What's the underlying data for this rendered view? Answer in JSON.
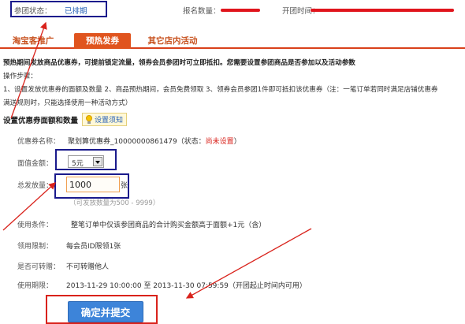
{
  "header": {
    "status_label": "参团状态：",
    "status_value": "已排期",
    "count_label": "报名数量：",
    "start_label": "开团时间："
  },
  "tabs": [
    {
      "label": "淘宝客推广",
      "active": false
    },
    {
      "label": "预热发券",
      "active": true
    },
    {
      "label": "其它店内活动",
      "active": false
    }
  ],
  "notice": {
    "headline": "预热期间发放商品优惠券，可提前锁定流量，领券会员参团时可立即抵扣。您需要设置参团商品是否参加以及活动参数",
    "steps_label": "操作步骤：",
    "steps_line1": "1、设置发放优惠券的面额及数量 2、商品预热期间，会员免费领取 3、领券会员参团1件即可抵扣该优惠券（注：一笔订单若同时满足店铺优惠券",
    "steps_line2": "满送规则时，只能选择使用一种活动方式）"
  },
  "section": {
    "title": "设置优惠券面额和数量",
    "add_setting": "设置须知"
  },
  "form": {
    "coupon_name_label": "优惠券名称：",
    "coupon_name_value": "聚划算优惠券_10000000861479（状态：",
    "coupon_status": "尚未设置",
    "coupon_name_close": "）",
    "face_value_label": "面值金额：",
    "face_value_selected": "5元",
    "total_label": "总发放量：",
    "total_value": "1000",
    "total_unit": "张",
    "total_hint": "（可发放数量为500 - 9999）",
    "condition_label": "使用条件：",
    "condition_value": "整笔订单中仅该参团商品的合计购买金额高于面额+1元（含）",
    "limit_label": "领用限制：",
    "limit_value": "每会员ID限领1张",
    "transfer_label": "是否可转赠：",
    "transfer_value": "不可转赠他人",
    "period_label": "使用期限：",
    "period_value": "2013-11-29 10:00:00 至 2013-11-30 07:59:59（开团起止时间内可用）"
  },
  "submit_label": "确定并提交",
  "colors": {
    "tab_active": "#e0541e",
    "tab_text": "#c8521f",
    "submit_blue": "#3d84d9",
    "highlight_navy": "#1a1a8c",
    "annotation_red": "#d9221b"
  }
}
